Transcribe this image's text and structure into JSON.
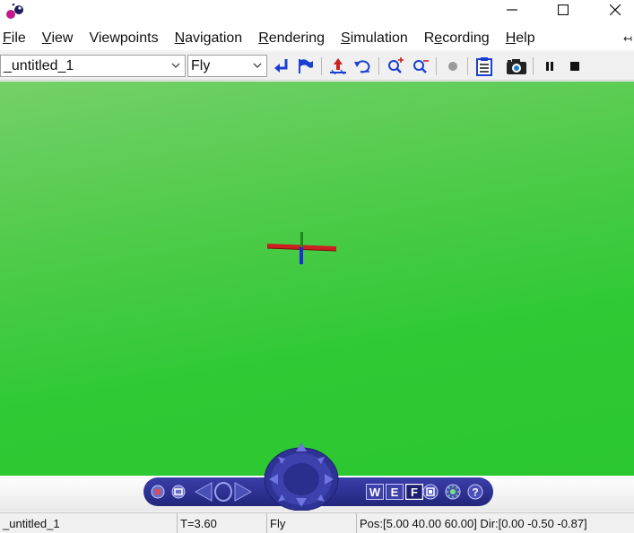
{
  "menu": {
    "items": [
      {
        "label": "File",
        "accel": "F",
        "rest": "ile"
      },
      {
        "label": "View",
        "accel": "V",
        "rest": "iew"
      },
      {
        "label": "Viewpoints",
        "accel": "",
        "rest": "Viewpoints"
      },
      {
        "label": "Navigation",
        "accel": "N",
        "rest": "avigation"
      },
      {
        "label": "Rendering",
        "accel": "R",
        "rest": "endering"
      },
      {
        "label": "Simulation",
        "accel": "S",
        "rest": "imulation"
      },
      {
        "label": "Recording",
        "accel": "e",
        "pre": "R",
        "rest": "cording"
      },
      {
        "label": "Help",
        "accel": "H",
        "rest": "elp"
      }
    ]
  },
  "toolbar": {
    "viewpoint_value": "_untitled_1",
    "nav_mode_value": "Fly"
  },
  "status": {
    "world": "_untitled_1",
    "time": "T=3.60",
    "mode": "Fly",
    "position": "Pos:[5.00 40.00 60.00] Dir:[0.00 -0.50 -0.87]"
  },
  "navbar": {
    "walk_label": "W",
    "examine_label": "E",
    "fly_label": "F",
    "help_label": "?"
  },
  "colors": {
    "viewport_top": "#74d068",
    "viewport_bottom": "#2bc72f",
    "navbar": "#2c2f8e",
    "axis_x": "#cc1f1f",
    "axis_y": "#1a8a1a",
    "axis_z": "#1a2fd8"
  }
}
